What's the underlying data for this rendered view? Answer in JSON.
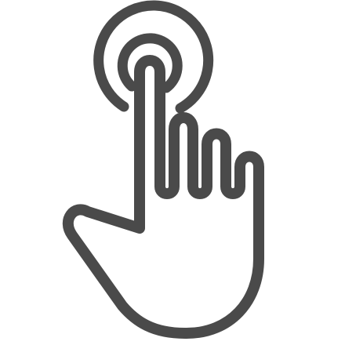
{
  "icon": {
    "name": "tap-gesture-icon",
    "color": "#4a4a4a",
    "background": "#ffffff"
  }
}
